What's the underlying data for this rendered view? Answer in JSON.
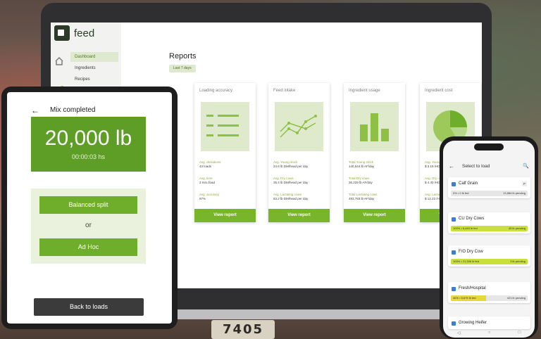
{
  "background": {
    "plate_text": "7405"
  },
  "laptop": {
    "brand": "feed",
    "nav": [
      "Dashboard",
      "Ingredients",
      "Recipes"
    ],
    "reports_title": "Reports",
    "date_range": "Last 7 days",
    "cards": [
      {
        "title": "Loading accuracy",
        "button": "View report",
        "lines": [
          [
            "Avg. deviations",
            "43 loads"
          ],
          [
            "Avg. time",
            "3 min./load"
          ],
          [
            "Avg. accuracy",
            "97%"
          ]
        ]
      },
      {
        "title": "Feed intake",
        "button": "View report",
        "lines": [
          [
            "Avg. Young stock",
            "24.6 lb DM/head per day"
          ],
          [
            "Avg. Dry cows",
            "35.4 lb DM/head per day"
          ],
          [
            "Avg. Lactating cows",
            "53.2 lb DM/head per day"
          ]
        ]
      },
      {
        "title": "Ingredient usage",
        "button": "View report",
        "lines": [
          [
            "Total Young stock",
            "140,544 lb AF/day"
          ],
          [
            "Total Dry cows",
            "36,229 lb AF/day"
          ],
          [
            "Total Lactating cows",
            "493,783 lb AF/day"
          ]
        ]
      },
      {
        "title": "Ingredient cost",
        "button": "View report",
        "lines": [
          [
            "Avg. Young stock",
            "$ 3.19 /HD per day"
          ],
          [
            "Avg. Dry cows",
            "$ 4.40 /HD per day"
          ],
          [
            "Avg. Lactating cows",
            "$ 12.23 /HD per day"
          ]
        ]
      }
    ]
  },
  "tablet": {
    "back_icon": "←",
    "title": "Mix completed",
    "weight": "20,000 lb",
    "time": "00:00:03 hs",
    "option1": "Balanced split",
    "or": "or",
    "option2": "Ad Hoc",
    "back_button": "Back to loads"
  },
  "phone": {
    "back_icon": "←",
    "title": "Select to load",
    "search_icon": "🔍",
    "items": [
      {
        "name": "Calf Grain",
        "tag": "P",
        "left": "0% • 0 lb fed",
        "right": "13,584 lb pending",
        "progress": 0,
        "color": "#cfcfcf"
      },
      {
        "name": "CU Dry Cows",
        "tag": "",
        "left": "100% • 6,645 lb fed",
        "right": "45 lb pending",
        "progress": 100,
        "color": "#c8e03a"
      },
      {
        "name": "F/O Dry Cow",
        "tag": "",
        "left": "100% • 21,306 lb fed",
        "right": "3 lb pending",
        "progress": 100,
        "color": "#c8e03a"
      },
      {
        "name": "Fresh/Hospital",
        "tag": "",
        "left": "46% • 5,675 lb fed",
        "right": "421 lb pending",
        "progress": 46,
        "color": "#e6d83a"
      },
      {
        "name": "Growing Heifer",
        "tag": "",
        "left": "",
        "right": "",
        "progress": 0,
        "color": "#cfcfcf"
      }
    ],
    "nav": [
      "◁",
      "○",
      "□"
    ]
  }
}
